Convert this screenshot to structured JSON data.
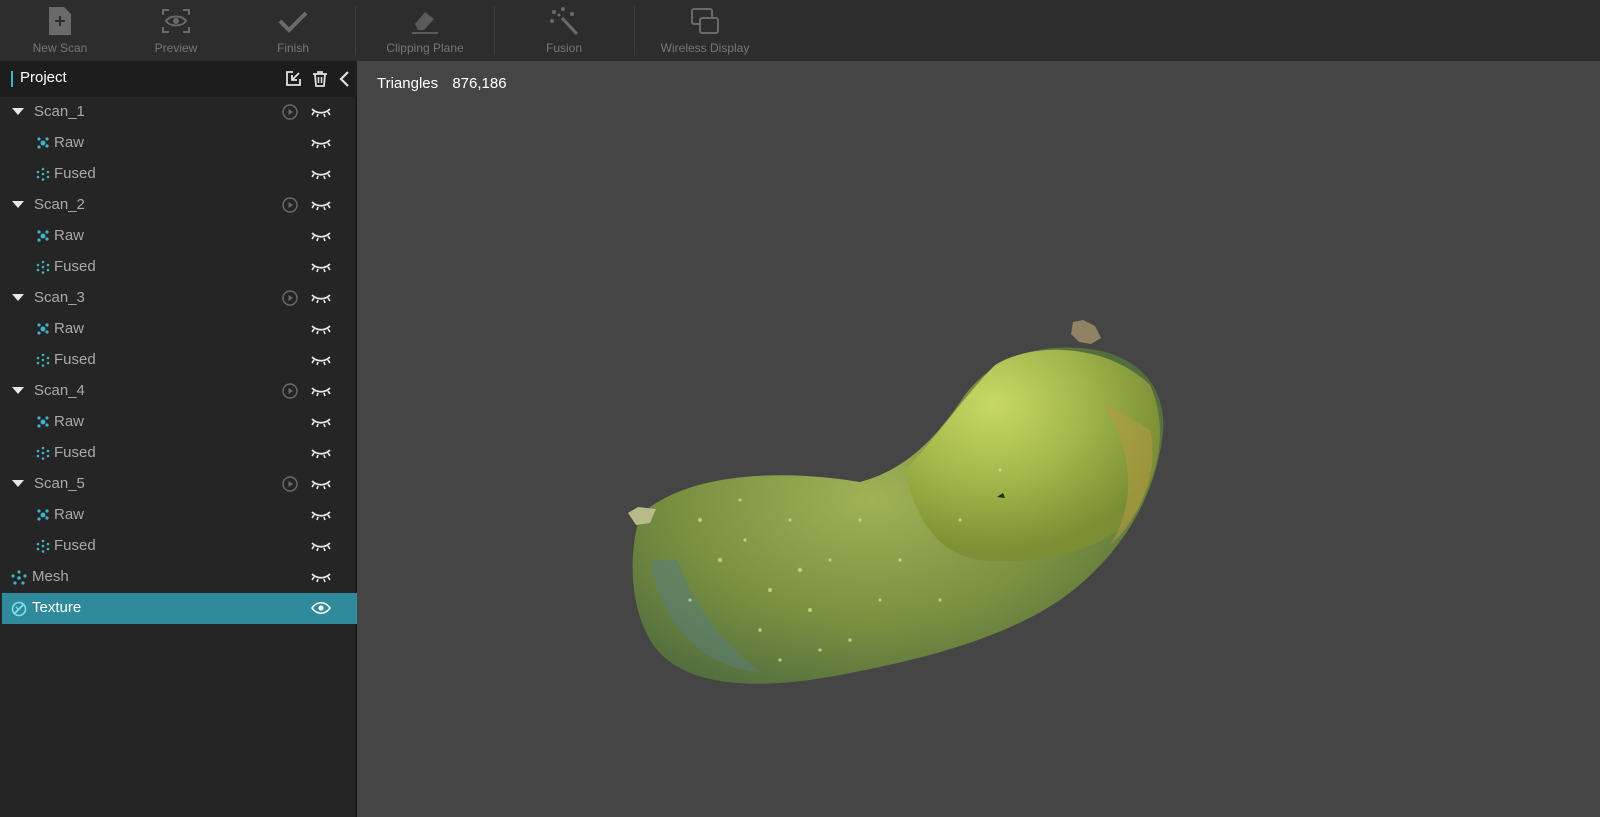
{
  "toolbar": {
    "new_scan": "New Scan",
    "preview": "Preview",
    "finish": "Finish",
    "clipping_plane": "Clipping Plane",
    "fusion": "Fusion",
    "wireless_display": "Wireless Display"
  },
  "sidebar": {
    "title": "Project",
    "items": [
      {
        "label": "Scan_1",
        "type": "scan"
      },
      {
        "label": "Raw",
        "type": "raw"
      },
      {
        "label": "Fused",
        "type": "fused"
      },
      {
        "label": "Scan_2",
        "type": "scan"
      },
      {
        "label": "Raw",
        "type": "raw"
      },
      {
        "label": "Fused",
        "type": "fused"
      },
      {
        "label": "Scan_3",
        "type": "scan"
      },
      {
        "label": "Raw",
        "type": "raw"
      },
      {
        "label": "Fused",
        "type": "fused"
      },
      {
        "label": "Scan_4",
        "type": "scan"
      },
      {
        "label": "Raw",
        "type": "raw"
      },
      {
        "label": "Fused",
        "type": "fused"
      },
      {
        "label": "Scan_5",
        "type": "scan"
      },
      {
        "label": "Raw",
        "type": "raw"
      },
      {
        "label": "Fused",
        "type": "fused"
      },
      {
        "label": "Mesh",
        "type": "mesh"
      },
      {
        "label": "Texture",
        "type": "texture",
        "selected": true
      }
    ]
  },
  "viewport": {
    "triangles_label": "Triangles",
    "triangles_value": "876,186"
  },
  "colors": {
    "accent": "#2f8b9c",
    "icon_teal": "#3fb3c7",
    "background": "#454545"
  }
}
